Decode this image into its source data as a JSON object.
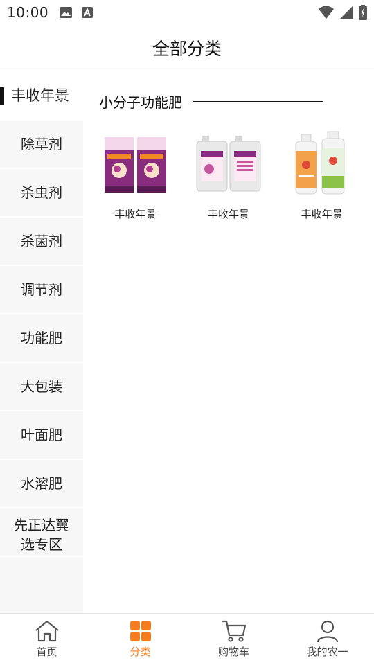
{
  "status_bar": {
    "time": "10:00"
  },
  "header": {
    "title": "全部分类"
  },
  "sidebar": {
    "items": [
      {
        "label": "丰收年景"
      },
      {
        "label": "除草剂"
      },
      {
        "label": "杀虫剂"
      },
      {
        "label": "杀菌剂"
      },
      {
        "label": "调节剂"
      },
      {
        "label": "功能肥"
      },
      {
        "label": "大包装"
      },
      {
        "label": "叶面肥"
      },
      {
        "label": "水溶肥"
      },
      {
        "label": "先正达翼选专区"
      }
    ]
  },
  "content": {
    "section_title": "小分子功能肥",
    "products": [
      {
        "name": "丰收年景",
        "image": "fertilizer-bags-icon"
      },
      {
        "name": "丰收年景",
        "image": "jerrycans-icon"
      },
      {
        "name": "丰收年景",
        "image": "bottles-icon"
      }
    ]
  },
  "tabbar": {
    "tabs": [
      {
        "label": "首页",
        "icon": "home-icon"
      },
      {
        "label": "分类",
        "icon": "category-icon"
      },
      {
        "label": "购物车",
        "icon": "cart-icon"
      },
      {
        "label": "我的农一",
        "icon": "user-icon"
      }
    ]
  },
  "colors": {
    "accent": "#f57c1f",
    "active_marker": "#111111",
    "sidebar_bg": "#f7f7f7"
  }
}
